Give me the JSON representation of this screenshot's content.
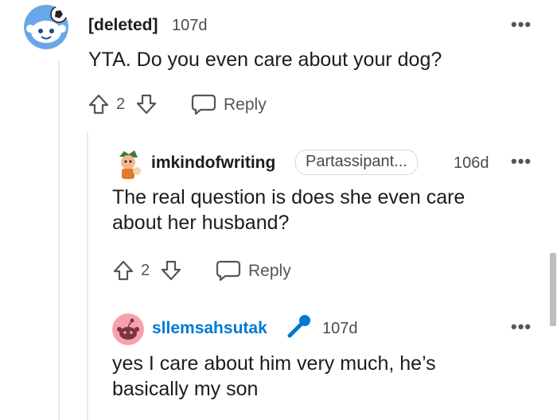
{
  "comments": [
    {
      "username": "[deleted]",
      "age": "107d",
      "text": "YTA. Do you even care about your dog?",
      "votes": "2",
      "reply_label": "Reply",
      "avatar_color": "#6aa7e8"
    },
    {
      "username": "imkindofwriting",
      "flair": "Partassipant...",
      "age": "106d",
      "lines": [
        "The real question is does she even care",
        "about her husband?"
      ],
      "votes": "2",
      "reply_label": "Reply"
    },
    {
      "username": "sllemsahsutak",
      "username_color": "#0079d3",
      "age": "107d",
      "lines": [
        "yes I care about him very much, he’s",
        "basically my son"
      ],
      "avatar_color": "#f7a1ad",
      "mic_color": "#0079d3"
    }
  ]
}
